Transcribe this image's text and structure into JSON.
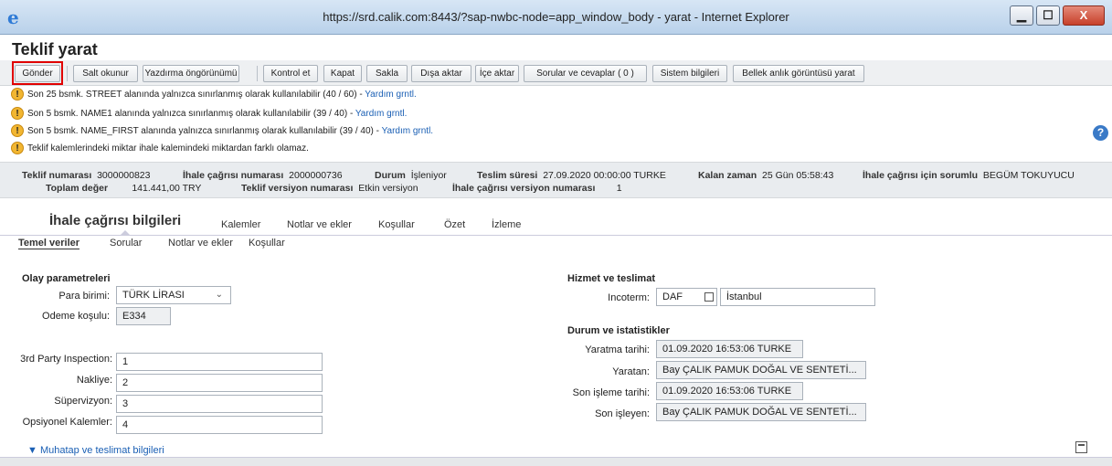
{
  "window": {
    "title": "https://srd.calik.com:8443/?sap-nwbc-node=app_window_body - yarat - Internet Explorer",
    "logo_glyph": "e",
    "min": "▁",
    "max": "☐",
    "close": "X"
  },
  "page_title": "Teklif yarat",
  "toolbar": {
    "gonder": "Gönder",
    "salt_okunur": "Salt okunur",
    "yazdirma": "Yazdırma öngörünümü",
    "kontrol": "Kontrol et",
    "kapat": "Kapat",
    "sakla": "Sakla",
    "disa_aktar": "Dışa aktar",
    "ice_aktar": "İçe aktar",
    "sorular": "Sorular ve cevaplar ( 0 )",
    "sistem": "Sistem bilgileri",
    "bellek": "Bellek anlık görüntüsü yarat",
    "help_glyph": "?"
  },
  "messages": [
    {
      "text": "Son 25 bsmk. STREET alanında yalnızca sınırlanmış olarak kullanılabilir (40 / 60) - ",
      "link": "Yardım grntl."
    },
    {
      "text": "Son 5 bsmk. NAME1 alanında yalnızca sınırlanmış olarak kullanılabilir (39 / 40) - ",
      "link": "Yardım grntl."
    },
    {
      "text": "Son 5 bsmk. NAME_FIRST alanında yalnızca sınırlanmış olarak kullanılabilir (39 / 40) - ",
      "link": "Yardım grntl."
    },
    {
      "text": "Teklif kalemlerindeki miktar ihale kalemindeki miktardan farklı olamaz.",
      "link": ""
    }
  ],
  "warn_glyph": "!",
  "header": {
    "teklif_no_label": "Teklif numarası",
    "teklif_no": "3000000823",
    "ihale_no_label": "İhale çağrısı numarası",
    "ihale_no": "2000000736",
    "durum_label": "Durum",
    "durum": "İşleniyor",
    "teslim_label": "Teslim süresi",
    "teslim": "27.09.2020 00:00:00 TURKE",
    "kalan_label": "Kalan zaman",
    "kalan": "25 Gün 05:58:43",
    "sorumlu_label": "İhale çağrısı için sorumlu",
    "sorumlu": "BEGÜM TOKUYUCU",
    "toplam_label": "Toplam değer",
    "toplam": "141.441,00 TRY",
    "versiyon_label": "Teklif versiyon numarası",
    "versiyon": "Etkin versiyon",
    "ihale_versiyon_label": "İhale çağrısı versiyon numarası",
    "ihale_versiyon": "1"
  },
  "main_tabs": [
    "İhale çağrısı bilgileri",
    "Kalemler",
    "Notlar ve ekler",
    "Koşullar",
    "Özet",
    "İzleme"
  ],
  "sub_tabs": [
    "Temel veriler",
    "Sorular",
    "Notlar ve ekler",
    "Koşullar"
  ],
  "olay": {
    "title": "Olay parametreleri",
    "para_label": "Para birimi:",
    "para_value": "TÜRK LİRASI",
    "odeme_label": "Odeme koşulu:",
    "odeme_value": "E334"
  },
  "custom": {
    "f1_label": "3rd Party Inspection:",
    "f1_value": "1",
    "f2_label": "Nakliye:",
    "f2_value": "2",
    "f3_label": "Süpervizyon:",
    "f3_value": "3",
    "f4_label": "Opsiyonel Kalemler:",
    "f4_value": "4"
  },
  "hizmet": {
    "title": "Hizmet ve teslimat",
    "incoterm_label": "Incoterm:",
    "incoterm_code": "DAF",
    "incoterm_place": "İstanbul"
  },
  "durum_ist": {
    "title": "Durum ve istatistikler",
    "yaratma_label": "Yaratma tarihi:",
    "yaratma_value": "01.09.2020 16:53:06 TURKE",
    "yaratan_label": "Yaratan:",
    "yaratan_value": "Bay ÇALIK PAMUK DOĞAL VE SENTETİ...",
    "son_isleme_label": "Son işleme tarihi:",
    "son_isleme_value": "01.09.2020 16:53:06 TURKE",
    "son_isleyen_label": "Son işleyen:",
    "son_isleyen_value": "Bay ÇALIK PAMUK DOĞAL VE SENTETİ..."
  },
  "footer": {
    "muhatap": "▼ Muhatap ve teslimat bilgileri"
  }
}
